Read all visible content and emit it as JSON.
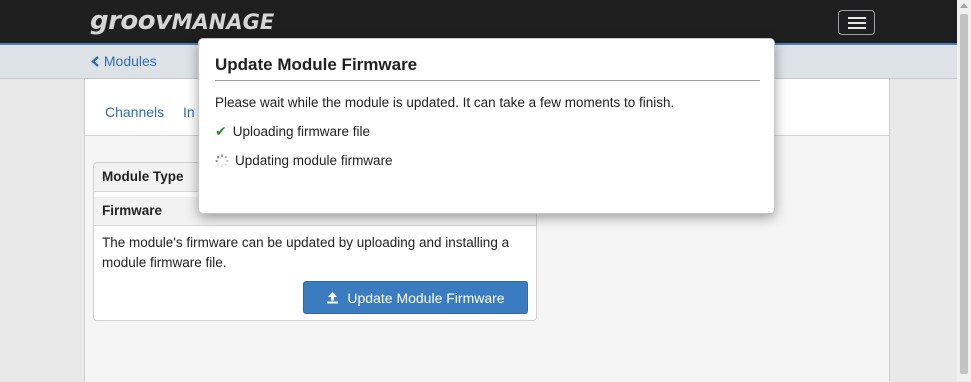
{
  "header": {
    "brand_part1": "groov",
    "brand_part2": "MANAGE",
    "menu_icon": "hamburger-menu-icon"
  },
  "subnav": {
    "back_label": "Modules",
    "back_icon": "chevron-left-icon"
  },
  "tabs": [
    {
      "label": "Channels"
    },
    {
      "label": "In"
    }
  ],
  "card": {
    "rows": [
      {
        "label": "Module Type",
        "value": ""
      },
      {
        "label": "Firmware",
        "value": ""
      }
    ],
    "description": "The module's firmware can be updated by uploading and installing a module firmware file.",
    "button_label": "Update Module Firmware",
    "button_icon": "upload-icon"
  },
  "modal": {
    "title": "Update Module Firmware",
    "message": "Please wait while the module is updated. It can take a few moments to finish.",
    "steps": [
      {
        "label": "Uploading firmware file",
        "status": "done",
        "icon": "checkmark-icon"
      },
      {
        "label": "Updating module firmware",
        "status": "in-progress",
        "icon": "spinner-icon"
      }
    ]
  },
  "colors": {
    "accent": "#3a7cbf",
    "link": "#2f6fae",
    "success": "#2e8b2e",
    "topbar": "#1f1f1f"
  }
}
